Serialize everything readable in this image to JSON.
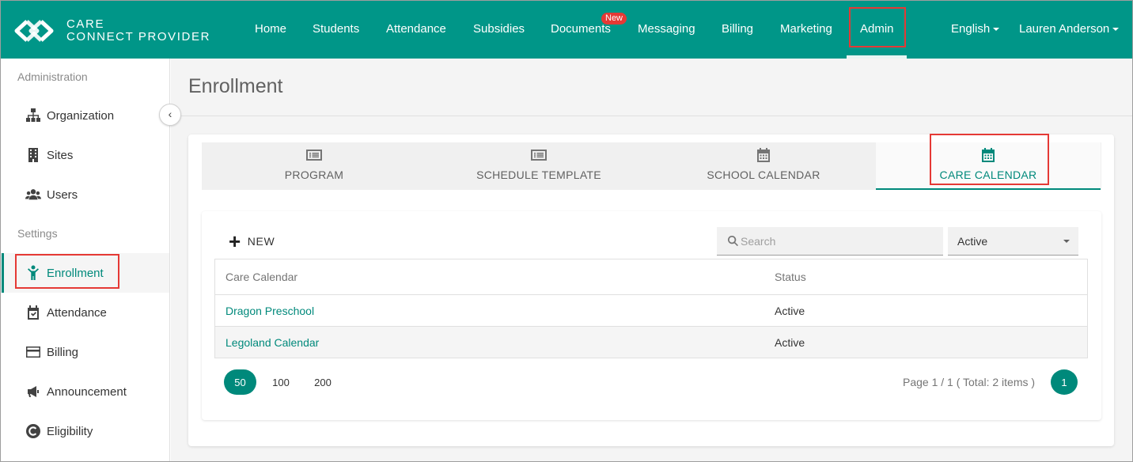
{
  "brand": {
    "line1": "CARE",
    "line2": "CONNECT PROVIDER",
    "accent": "#009688"
  },
  "topnav": {
    "items": [
      {
        "label": "Home"
      },
      {
        "label": "Students"
      },
      {
        "label": "Attendance"
      },
      {
        "label": "Subsidies"
      },
      {
        "label": "Documents",
        "badge": "New"
      },
      {
        "label": "Messaging"
      },
      {
        "label": "Billing"
      },
      {
        "label": "Marketing"
      },
      {
        "label": "Admin",
        "active": true
      }
    ],
    "language": "English",
    "user": "Lauren Anderson"
  },
  "sidebar": {
    "section_admin": "Administration",
    "section_settings": "Settings",
    "admin_items": [
      {
        "label": "Organization",
        "icon": "sitemap-icon"
      },
      {
        "label": "Sites",
        "icon": "building-icon"
      },
      {
        "label": "Users",
        "icon": "users-icon"
      }
    ],
    "settings_items": [
      {
        "label": "Enrollment",
        "icon": "child-icon",
        "active": true
      },
      {
        "label": "Attendance",
        "icon": "calendar-check-icon"
      },
      {
        "label": "Billing",
        "icon": "credit-card-icon"
      },
      {
        "label": "Announcement",
        "icon": "megaphone-icon"
      },
      {
        "label": "Eligibility",
        "icon": "copyright-icon"
      }
    ]
  },
  "page": {
    "title": "Enrollment"
  },
  "tabs": [
    {
      "label": "PROGRAM",
      "icon": "list-alt-icon"
    },
    {
      "label": "SCHEDULE TEMPLATE",
      "icon": "list-alt-icon"
    },
    {
      "label": "SCHOOL CALENDAR",
      "icon": "calendar-icon"
    },
    {
      "label": "CARE CALENDAR",
      "icon": "calendar-icon",
      "active": true
    }
  ],
  "toolbar": {
    "new_label": "NEW",
    "search_placeholder": "Search",
    "status_value": "Active"
  },
  "table": {
    "headers": [
      "Care Calendar",
      "Status"
    ],
    "rows": [
      {
        "name": "Dragon Preschool",
        "status": "Active"
      },
      {
        "name": "Legoland Calendar",
        "status": "Active"
      }
    ]
  },
  "pagination": {
    "sizes": [
      "50",
      "100",
      "200"
    ],
    "active_size": "50",
    "info": "Page 1 / 1 ( Total: 2 items )",
    "current_page": "1"
  }
}
